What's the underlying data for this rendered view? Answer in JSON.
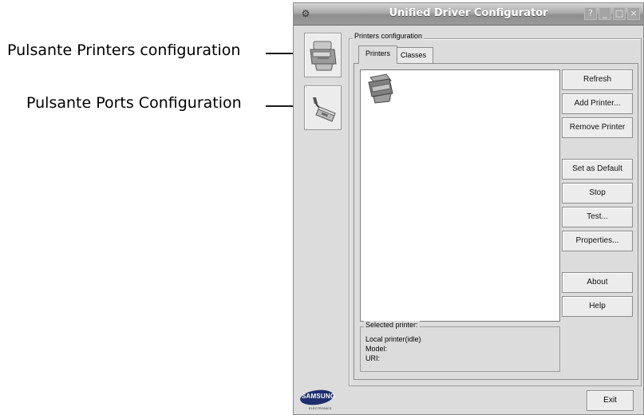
{
  "annotations": {
    "printers_button": "Pulsante Printers configuration",
    "ports_button": "Pulsante Ports Configuration"
  },
  "window": {
    "title": "Unified Driver Configurator",
    "controls": [
      "?",
      "_",
      "□",
      "×"
    ]
  },
  "sidebar": {
    "items": [
      {
        "name": "printers-configuration",
        "icon": "printer-icon",
        "selected": true
      },
      {
        "name": "ports-configuration",
        "icon": "port-icon",
        "selected": false
      }
    ]
  },
  "group": {
    "legend": "Printers configuration",
    "tabs": [
      {
        "label": "Printers",
        "active": true
      },
      {
        "label": "Classes",
        "active": false
      }
    ]
  },
  "buttons": {
    "refresh": "Refresh",
    "add_printer": "Add Printer...",
    "remove_printer": "Remove Printer",
    "set_default": "Set as Default",
    "stop": "Stop",
    "test": "Test...",
    "properties": "Properties...",
    "about": "About",
    "help": "Help"
  },
  "selected_printer": {
    "legend": "Selected printer:",
    "status": "Local printer(idle)",
    "model": "Model:",
    "uri": "URI:"
  },
  "footer": {
    "exit": "Exit",
    "logo_brand": "SAMSUNG",
    "logo_sub": "ELECTRONICS"
  }
}
